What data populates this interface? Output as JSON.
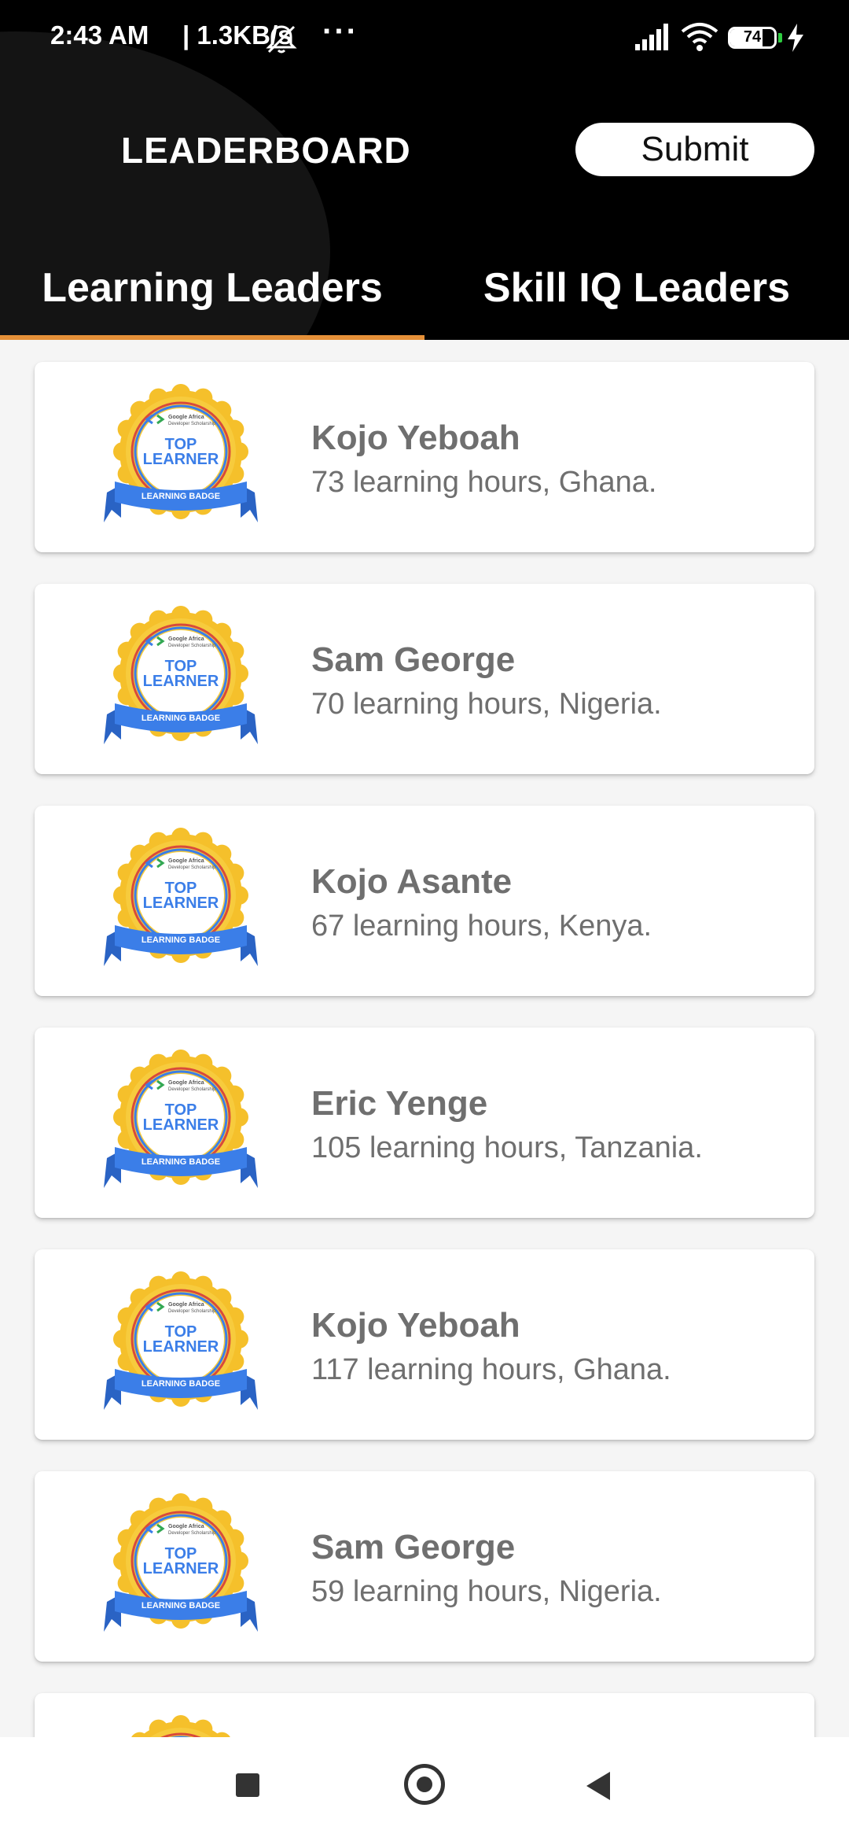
{
  "status_bar": {
    "time": "2:43 AM",
    "network_speed": "| 1.3KB/s",
    "more": "···",
    "battery_level": "74",
    "battery_fraction": 0.74,
    "icons": [
      "mute-notifications-icon",
      "signal-icon",
      "wifi-icon",
      "battery-icon",
      "charging-icon"
    ]
  },
  "header": {
    "title": "LEADERBOARD",
    "submit_label": "Submit"
  },
  "tabs": [
    {
      "label": "Learning Leaders",
      "selected": true
    },
    {
      "label": "Skill IQ Leaders",
      "selected": false
    }
  ],
  "badge": {
    "brand_line1": "Google Africa",
    "brand_line2": "Developer Scholarship",
    "top": "TOP",
    "learner": "LEARNER",
    "ribbon": "LEARNING BADGE"
  },
  "leaders": [
    {
      "name": "Kojo Yeboah",
      "detail": "73 learning hours, Ghana."
    },
    {
      "name": "Sam George",
      "detail": "70 learning hours, Nigeria."
    },
    {
      "name": "Kojo Asante",
      "detail": "67 learning hours, Kenya."
    },
    {
      "name": "Eric Yenge",
      "detail": "105 learning hours, Tanzania."
    },
    {
      "name": "Kojo Yeboah",
      "detail": "117 learning hours, Ghana."
    },
    {
      "name": "Sam George",
      "detail": "59 learning hours, Nigeria."
    }
  ],
  "colors": {
    "header_bg": "#000000",
    "tab_indicator": "#e59038",
    "badge_gold": "#f5c02b",
    "badge_ribbon": "#3b7ee8",
    "text_muted": "#6f6f6f"
  }
}
